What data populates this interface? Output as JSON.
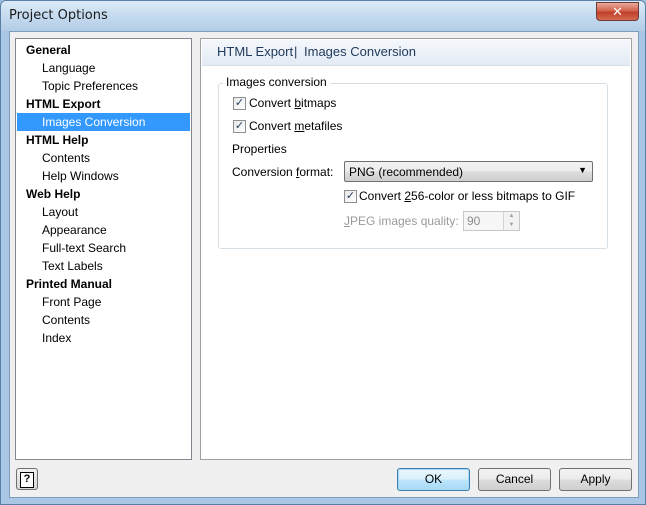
{
  "window": {
    "title": "Project Options",
    "close_glyph": "✕"
  },
  "nav": [
    {
      "label": "General",
      "type": "group"
    },
    {
      "label": "Language",
      "type": "item"
    },
    {
      "label": "Topic Preferences",
      "type": "item"
    },
    {
      "label": "HTML Export",
      "type": "group"
    },
    {
      "label": "Images Conversion",
      "type": "item",
      "selected": true
    },
    {
      "label": "HTML Help",
      "type": "group"
    },
    {
      "label": "Contents",
      "type": "item"
    },
    {
      "label": "Help Windows",
      "type": "item"
    },
    {
      "label": "Web Help",
      "type": "group"
    },
    {
      "label": "Layout",
      "type": "item"
    },
    {
      "label": "Appearance",
      "type": "item"
    },
    {
      "label": "Full-text Search",
      "type": "item"
    },
    {
      "label": "Text Labels",
      "type": "item"
    },
    {
      "label": "Printed Manual",
      "type": "group"
    },
    {
      "label": "Front Page",
      "type": "item"
    },
    {
      "label": "Contents",
      "type": "item"
    },
    {
      "label": "Index",
      "type": "item"
    }
  ],
  "panel": {
    "header_left": "HTML Export",
    "header_sep": "|",
    "header_right": "Images Conversion",
    "group_title": "Images conversion",
    "convert_bitmaps": {
      "pre": "Convert ",
      "accel": "b",
      "post": "itmaps",
      "checked": true
    },
    "convert_metafiles": {
      "pre": "Convert ",
      "accel": "m",
      "post": "etafiles",
      "checked": true
    },
    "properties_label": "Properties",
    "conversion_format": {
      "pre": "Conversion ",
      "accel": "f",
      "post": "ormat:"
    },
    "format_value": "PNG (recommended)",
    "convert_256": {
      "pre": "Convert ",
      "accel": "2",
      "post": "56-color or less bitmaps to GIF",
      "checked": true
    },
    "jpeg_quality": {
      "accel": "J",
      "post": "PEG images quality:"
    },
    "jpeg_value": "90",
    "check_glyph": "✓"
  },
  "footer": {
    "help_glyph": "?",
    "ok": "OK",
    "cancel": "Cancel",
    "apply": "Apply"
  }
}
